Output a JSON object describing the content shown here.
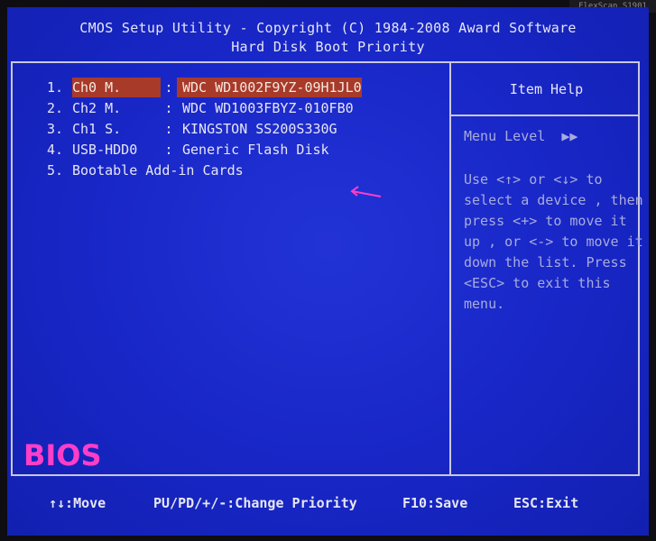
{
  "bezel": {
    "label": "FlexScan S1901"
  },
  "header": {
    "line1": "CMOS Setup Utility - Copyright (C) 1984-2008 Award Software",
    "line2": "Hard Disk Boot Priority"
  },
  "boot_list": [
    {
      "num": "1.",
      "channel": "Ch0 M.",
      "sep": ":",
      "device": "WDC WD1002F9YZ-09H1JL0",
      "selected": true
    },
    {
      "num": "2.",
      "channel": "Ch2 M.",
      "sep": ":",
      "device": "WDC WD1003FBYZ-010FB0",
      "selected": false
    },
    {
      "num": "3.",
      "channel": "Ch1 S.",
      "sep": ":",
      "device": "KINGSTON SS200S330G",
      "selected": false
    },
    {
      "num": "4.",
      "channel": "USB-HDD0",
      "sep": ":",
      "device": "Generic Flash Disk",
      "selected": false
    },
    {
      "num": "5.",
      "channel": "Bootable Add-in Cards",
      "sep": "",
      "device": "",
      "selected": false
    }
  ],
  "help": {
    "title": "Item Help",
    "menu_level_label": "Menu Level",
    "menu_level_arrows": "▶▶",
    "lines": [
      "Use <↑> or <↓> to",
      "select a device , then",
      "press <+> to move it",
      "up , or <-> to move it",
      "down the list. Press",
      "<ESC> to exit this",
      "menu."
    ]
  },
  "watermark": "BIOS",
  "footer": {
    "move": "↑↓:Move",
    "change": "PU/PD/+/-:Change Priority",
    "save": "F10:Save",
    "exit": "ESC:Exit"
  },
  "colors": {
    "background": "#1826c6",
    "highlight": "#a83a2a",
    "text": "#e6e6f2",
    "help_text": "#a8acdc",
    "watermark": "#ff3ec8",
    "pointer": "#ff3ec8"
  }
}
